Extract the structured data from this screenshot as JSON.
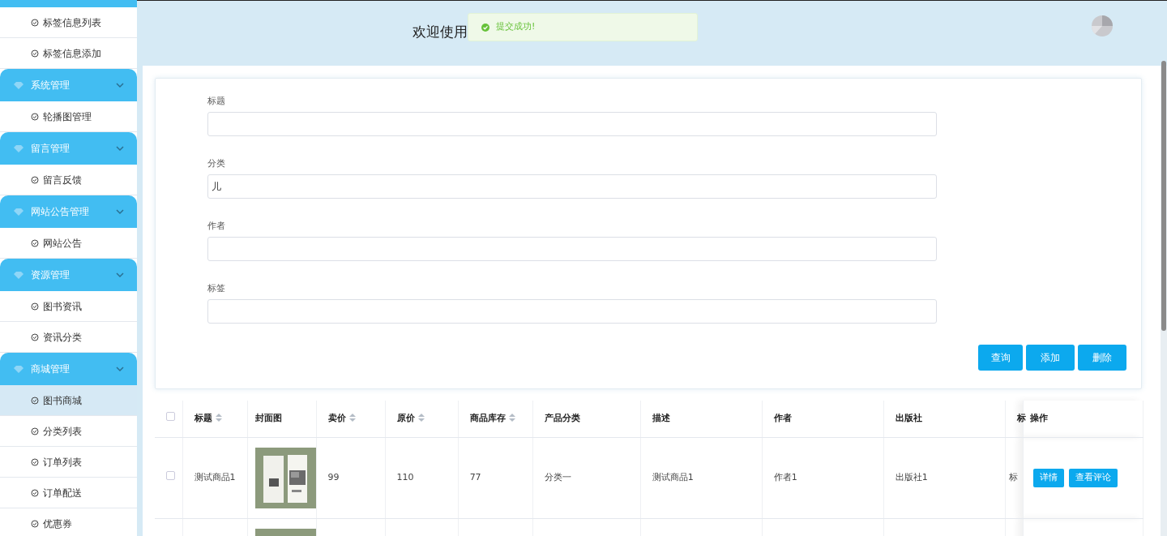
{
  "sidebar": {
    "groups": [
      {
        "children": [
          {
            "label": "标签信息列表",
            "selected": false
          },
          {
            "label": "标签信息添加",
            "selected": false
          }
        ]
      },
      {
        "title": "系统管理",
        "expanded": true,
        "children": [
          {
            "label": "轮播图管理",
            "selected": false
          }
        ]
      },
      {
        "title": "留言管理",
        "expanded": true,
        "children": [
          {
            "label": "留言反馈",
            "selected": false
          }
        ]
      },
      {
        "title": "网站公告管理",
        "expanded": true,
        "children": [
          {
            "label": "网站公告",
            "selected": false
          }
        ]
      },
      {
        "title": "资源管理",
        "expanded": true,
        "children": [
          {
            "label": "图书资讯",
            "selected": false
          },
          {
            "label": "资讯分类",
            "selected": false
          }
        ]
      },
      {
        "title": "商城管理",
        "expanded": true,
        "children": [
          {
            "label": "图书商城",
            "selected": true
          },
          {
            "label": "分类列表",
            "selected": false
          },
          {
            "label": "订单列表",
            "selected": false
          },
          {
            "label": "订单配送",
            "selected": false
          },
          {
            "label": "优惠券",
            "selected": false
          }
        ]
      }
    ]
  },
  "header": {
    "welcome": "欢迎使用"
  },
  "toast": {
    "message": "提交成功!"
  },
  "form": {
    "fields": [
      {
        "label": "标题"
      },
      {
        "label": "分类",
        "value": "儿"
      },
      {
        "label": "作者"
      },
      {
        "label": "标签"
      }
    ],
    "buttons": [
      "查询",
      "添加",
      "删除"
    ]
  },
  "table": {
    "select_all_checked": false,
    "columns": [
      {
        "label": "标题",
        "sortable": true
      },
      {
        "label": "封面图",
        "sortable": false
      },
      {
        "label": "卖价",
        "sortable": true
      },
      {
        "label": "原价",
        "sortable": true
      },
      {
        "label": "商品库存",
        "sortable": true
      },
      {
        "label": "产品分类",
        "sortable": false
      },
      {
        "label": "描述",
        "sortable": false
      },
      {
        "label": "作者",
        "sortable": false
      },
      {
        "label": "出版社",
        "sortable": false
      },
      {
        "label": "标",
        "sortable": false
      },
      {
        "label": "操作",
        "sortable": false
      }
    ],
    "rows": [
      {
        "checked": false,
        "cells": [
          "测试商品1",
          {
            "kind": "picture"
          },
          "99",
          "110",
          "77",
          "分类一",
          "测试商品1",
          "作者1",
          "出版社1",
          "标"
        ],
        "actions": [
          "详情",
          "查看评论"
        ]
      },
      {
        "cells": [
          null,
          {
            "kind": "picture"
          },
          null,
          null,
          null,
          null,
          null,
          null,
          null,
          null
        ]
      }
    ]
  }
}
